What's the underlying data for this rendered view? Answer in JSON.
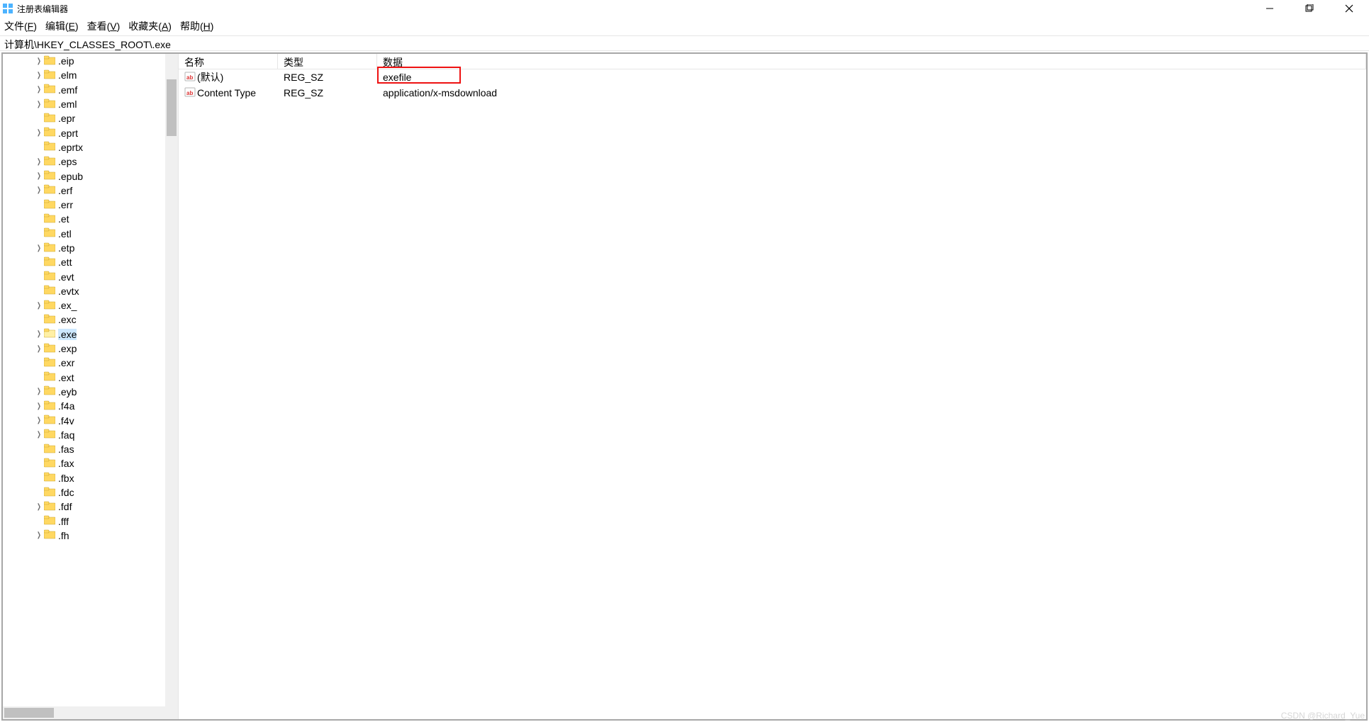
{
  "window": {
    "title": "注册表编辑器"
  },
  "menu": {
    "file": "文件(",
    "file_key": "F",
    "file_tail": ")",
    "edit": "编辑(",
    "edit_key": "E",
    "edit_tail": ")",
    "view": "查看(",
    "view_key": "V",
    "view_tail": ")",
    "fav": "收藏夹(",
    "fav_key": "A",
    "fav_tail": ")",
    "help": "帮助(",
    "help_key": "H",
    "help_tail": ")"
  },
  "address": "计算机\\HKEY_CLASSES_ROOT\\.exe",
  "list": {
    "header": {
      "name": "名称",
      "type": "类型",
      "data": "数据"
    },
    "rows": [
      {
        "name": "(默认)",
        "type": "REG_SZ",
        "data": "exefile",
        "highlighted": true
      },
      {
        "name": "Content Type",
        "type": "REG_SZ",
        "data": "application/x-msdownload",
        "highlighted": false
      }
    ]
  },
  "tree": {
    "items": [
      {
        "label": ".eip",
        "exp": true
      },
      {
        "label": ".elm",
        "exp": true
      },
      {
        "label": ".emf",
        "exp": true
      },
      {
        "label": ".eml",
        "exp": true
      },
      {
        "label": ".epr",
        "exp": false
      },
      {
        "label": ".eprt",
        "exp": true
      },
      {
        "label": ".eprtx",
        "exp": false
      },
      {
        "label": ".eps",
        "exp": true
      },
      {
        "label": ".epub",
        "exp": true
      },
      {
        "label": ".erf",
        "exp": true
      },
      {
        "label": ".err",
        "exp": false
      },
      {
        "label": ".et",
        "exp": false
      },
      {
        "label": ".etl",
        "exp": false
      },
      {
        "label": ".etp",
        "exp": true
      },
      {
        "label": ".ett",
        "exp": false
      },
      {
        "label": ".evt",
        "exp": false
      },
      {
        "label": ".evtx",
        "exp": false
      },
      {
        "label": ".ex_",
        "exp": true
      },
      {
        "label": ".exc",
        "exp": false
      },
      {
        "label": ".exe",
        "exp": true,
        "selected": true
      },
      {
        "label": ".exp",
        "exp": true
      },
      {
        "label": ".exr",
        "exp": false
      },
      {
        "label": ".ext",
        "exp": false
      },
      {
        "label": ".eyb",
        "exp": true
      },
      {
        "label": ".f4a",
        "exp": true
      },
      {
        "label": ".f4v",
        "exp": true
      },
      {
        "label": ".faq",
        "exp": true
      },
      {
        "label": ".fas",
        "exp": false
      },
      {
        "label": ".fax",
        "exp": false
      },
      {
        "label": ".fbx",
        "exp": false
      },
      {
        "label": ".fdc",
        "exp": false
      },
      {
        "label": ".fdf",
        "exp": true
      },
      {
        "label": ".fff",
        "exp": false
      },
      {
        "label": ".fh",
        "exp": true
      }
    ]
  },
  "watermark": "CSDN @Richard_Yue"
}
